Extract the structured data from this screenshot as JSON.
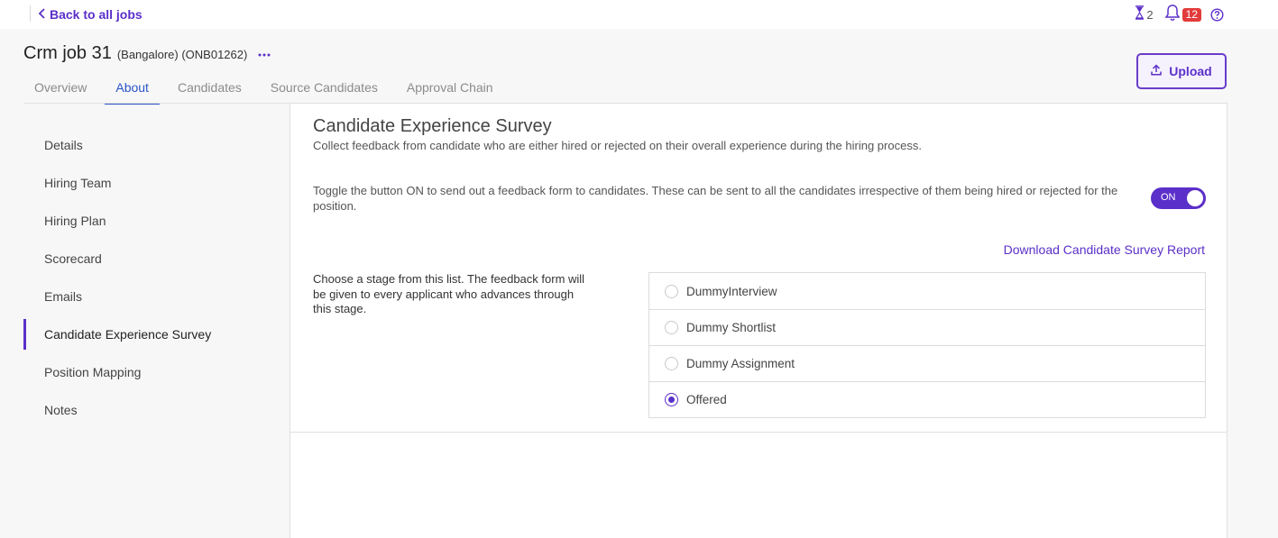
{
  "topbar": {
    "back_label": "Back to all jobs",
    "pending_count": "2",
    "notification_count": "12"
  },
  "job": {
    "title": "Crm job 31",
    "meta": "(Bangalore) (ONB01262)"
  },
  "tabs": [
    {
      "label": "Overview"
    },
    {
      "label": "About"
    },
    {
      "label": "Candidates"
    },
    {
      "label": "Source Candidates"
    },
    {
      "label": "Approval Chain"
    }
  ],
  "active_tab": "About",
  "upload_label": "Upload",
  "sidenav": {
    "items": [
      {
        "label": "Details"
      },
      {
        "label": "Hiring Team"
      },
      {
        "label": "Hiring Plan"
      },
      {
        "label": "Scorecard"
      },
      {
        "label": "Emails"
      },
      {
        "label": "Candidate Experience Survey"
      },
      {
        "label": "Position Mapping"
      },
      {
        "label": "Notes"
      }
    ],
    "active": "Candidate Experience Survey"
  },
  "survey": {
    "title": "Candidate Experience Survey",
    "subtitle": "Collect feedback from candidate who are either hired or rejected on their overall experience during the hiring process.",
    "toggle_text": "Toggle the button ON to send out a feedback form to candidates. These can be sent to all the candidates irrespective of them being hired or rejected for the position.",
    "toggle_label": "ON",
    "download_label": "Download Candidate Survey Report",
    "stage_description": "Choose a stage from this list. The feedback form will be given to every applicant who advances through this stage.",
    "stages": [
      {
        "label": "DummyInterview"
      },
      {
        "label": "Dummy Shortlist"
      },
      {
        "label": "Dummy Assignment"
      },
      {
        "label": "Offered"
      }
    ],
    "selected_stage": "Offered"
  },
  "colors": {
    "accent": "#5b2fc9",
    "tab_active": "#2a55c8",
    "badge": "#e23b3b"
  }
}
